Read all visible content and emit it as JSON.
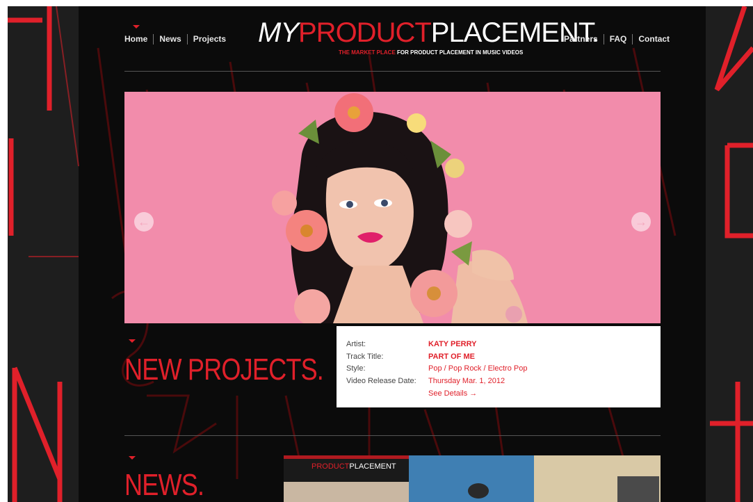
{
  "header": {
    "nav_left": [
      "Home",
      "News",
      "Projects"
    ],
    "nav_right": [
      "Partners",
      "FAQ",
      "Contact"
    ],
    "logo": {
      "my": "MY",
      "product": "PRODUCT",
      "placement": "PLACEMENT.",
      "tagline_red": "THE MARKET PLACE",
      "tagline_white": "FOR PRODUCT PLACEMENT IN MUSIC VIDEOS"
    }
  },
  "colors": {
    "accent": "#e0202a",
    "background": "#0b0b0b",
    "hero_bg": "#f08aa8"
  },
  "hero": {
    "prev_icon": "arrow-left-icon",
    "next_icon": "arrow-right-icon"
  },
  "new_projects": {
    "title": "NEW PROJECTS.",
    "fields": [
      {
        "label": "Artist:",
        "value": "KATY PERRY",
        "bold": true
      },
      {
        "label": "Track Title:",
        "value": "PART OF ME",
        "bold": true
      },
      {
        "label": "Style:",
        "value": "Pop / Pop Rock / Electro Pop",
        "bold": false
      },
      {
        "label": "Video Release Date:",
        "value": "Thursday Mar. 1, 2012",
        "bold": false
      }
    ],
    "details_link": "See Details →"
  },
  "news": {
    "title": "NEWS.",
    "thumb_logo_product": "PRODUCT",
    "thumb_logo_placement": "PLACEMENT"
  }
}
